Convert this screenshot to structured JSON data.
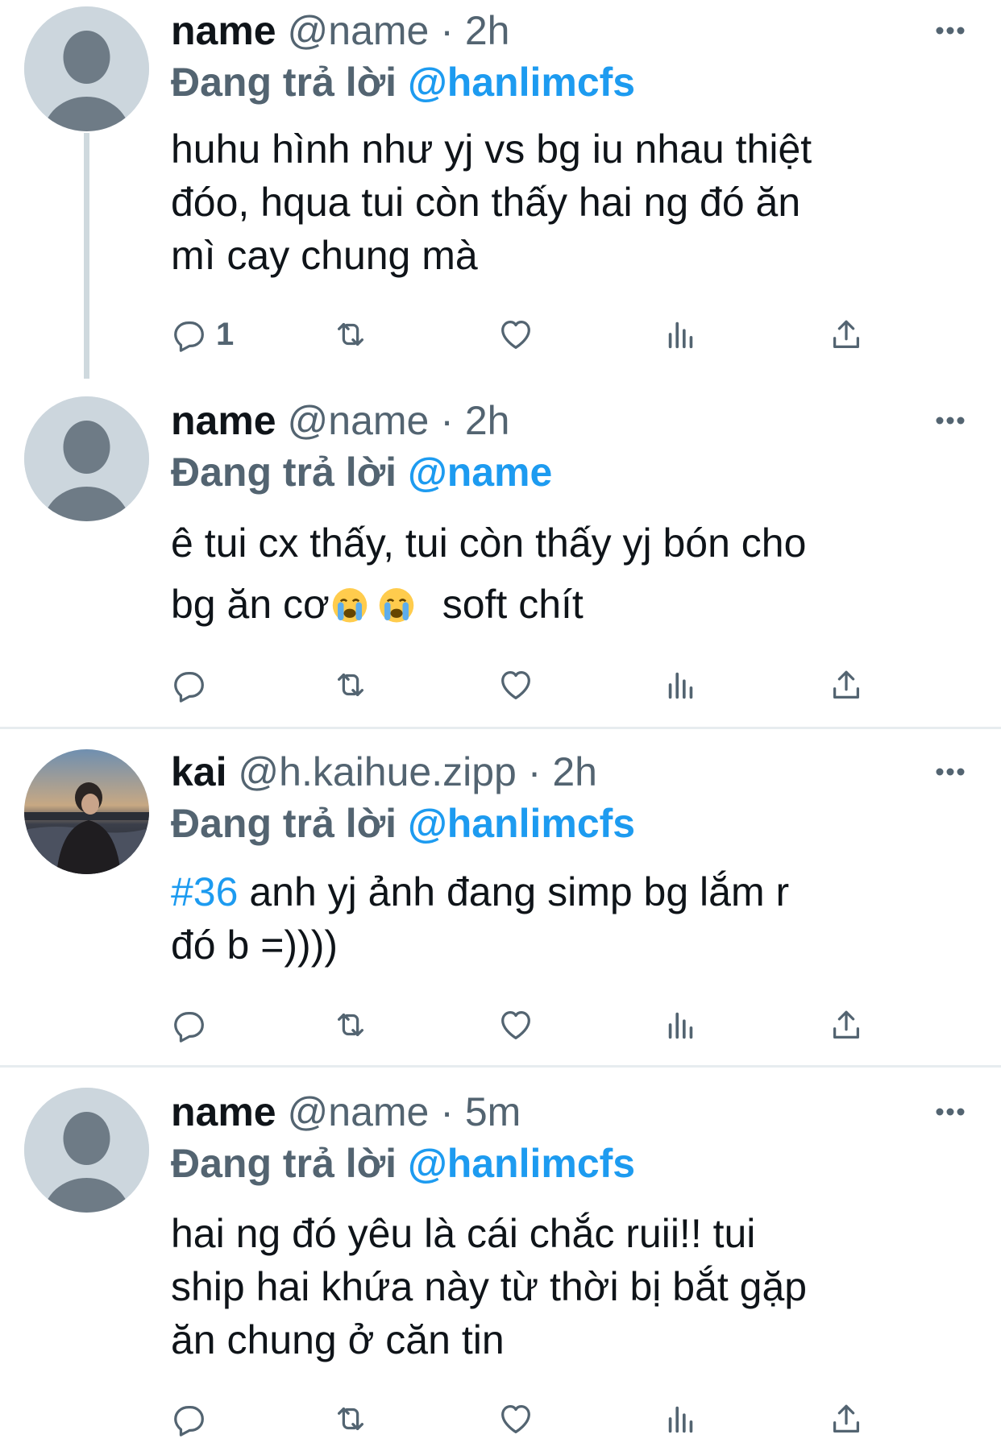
{
  "colors": {
    "accent": "#1d9bf0",
    "secondary_text": "#536471",
    "avatar_bg": "#ccd6dd"
  },
  "tweets": [
    {
      "name": "name",
      "handle": "@name",
      "sep": "·",
      "time": "2h",
      "reply_prefix": "Đang trả lời",
      "reply_to": "@hanlimcfs",
      "text_lines": [
        "huhu hình như yj vs bg iu nhau thiệt",
        "đóo, hqua tui còn thấy hai ng đó ăn",
        "mì cay chung mà"
      ],
      "reply_count": "1",
      "avatar": "default-avatar"
    },
    {
      "name": "name",
      "handle": "@name",
      "sep": "·",
      "time": "2h",
      "reply_prefix": "Đang trả lời",
      "reply_to": "@name",
      "text_line1": "ê tui cx thấy, tui còn thấy yj bón cho",
      "text_line2_start": "bg ăn cơ",
      "text_line2_end": "soft chít",
      "emoji": "loudly-crying-face",
      "reply_count": "",
      "avatar": "default-avatar"
    },
    {
      "name": "kai",
      "handle": "@h.kaihue.zipp",
      "sep": "·",
      "time": "2h",
      "reply_prefix": "Đang trả lời",
      "reply_to": "@hanlimcfs",
      "hashtag": "#36",
      "text_line1_rest": "anh yj ảnh đang simp bg lắm r",
      "text_line2": "đó b =))))",
      "reply_count": "",
      "avatar": "photo-avatar"
    },
    {
      "name": "name",
      "handle": "@name",
      "sep": "·",
      "time": "5m",
      "reply_prefix": "Đang trả lời",
      "reply_to": "@hanlimcfs",
      "text_lines": [
        "hai ng đó yêu là cái chắc ruii!! tui",
        "ship hai khứa này từ thời bị bắt gặp",
        "ăn chung ở căn tin"
      ],
      "reply_count": "",
      "avatar": "default-avatar"
    }
  ]
}
